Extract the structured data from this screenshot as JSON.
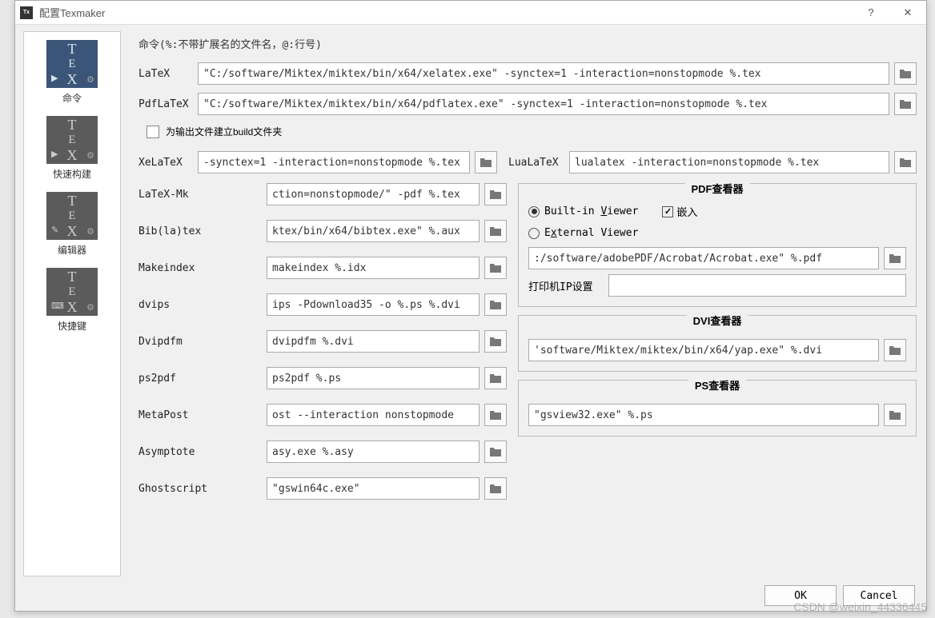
{
  "titlebar": {
    "title": "配置Texmaker"
  },
  "sidebar": [
    {
      "label": "命令",
      "sub": "▶",
      "selected": true
    },
    {
      "label": "快速构建",
      "sub": "▶"
    },
    {
      "label": "编辑器",
      "sub": "✎"
    },
    {
      "label": "快捷键",
      "sub": "⌨"
    }
  ],
  "hint": "命令(%:不带扩展名的文件名，@:行号)",
  "latex_label": "LaTeX",
  "latex_value": "\"C:/software/Miktex/miktex/bin/x64/xelatex.exe\" -synctex=1 -interaction=nonstopmode %.tex",
  "pdflatex_label": "PdfLaTeX",
  "pdflatex_value": "\"C:/software/Miktex/miktex/bin/x64/pdflatex.exe\" -synctex=1 -interaction=nonstopmode %.tex",
  "build_folder_label": "为输出文件建立build文件夹",
  "xelatex_label": "XeLaTeX",
  "xelatex_value": "-synctex=1 -interaction=nonstopmode %.tex",
  "lualatex_label": "LuaLaTeX",
  "lualatex_value": "lualatex -interaction=nonstopmode %.tex",
  "left_cmds": [
    {
      "label": "LaTeX-Mk",
      "value": "ction=nonstopmode/\" -pdf %.tex"
    },
    {
      "label": "Bib(la)tex",
      "value": "ktex/bin/x64/bibtex.exe\" %.aux"
    },
    {
      "label": "Makeindex",
      "value": "makeindex %.idx"
    },
    {
      "label": "dvips",
      "value": "ips -Pdownload35 -o %.ps %.dvi"
    },
    {
      "label": "Dvipdfm",
      "value": "dvipdfm %.dvi"
    },
    {
      "label": "ps2pdf",
      "value": "ps2pdf %.ps"
    },
    {
      "label": "MetaPost",
      "value": "ost --interaction nonstopmode"
    },
    {
      "label": "Asymptote",
      "value": "asy.exe %.asy"
    },
    {
      "label": "Ghostscript",
      "value": "\"gswin64c.exe\""
    }
  ],
  "pdf_viewer": {
    "title": "PDF查看器",
    "builtin": "Built-in Viewer",
    "embed": "嵌入",
    "external": "External Viewer",
    "path": ":/software/adobePDF/Acrobat/Acrobat.exe\" %.pdf",
    "printer_label": "打印机IP设置",
    "printer_value": ""
  },
  "dvi_viewer": {
    "title": "DVI查看器",
    "path": "'software/Miktex/miktex/bin/x64/yap.exe\" %.dvi"
  },
  "ps_viewer": {
    "title": "PS查看器",
    "path": "\"gsview32.exe\" %.ps"
  },
  "footer": {
    "ok": "OK",
    "cancel": "Cancel"
  },
  "watermark": "CSDN @weixin_44336445"
}
